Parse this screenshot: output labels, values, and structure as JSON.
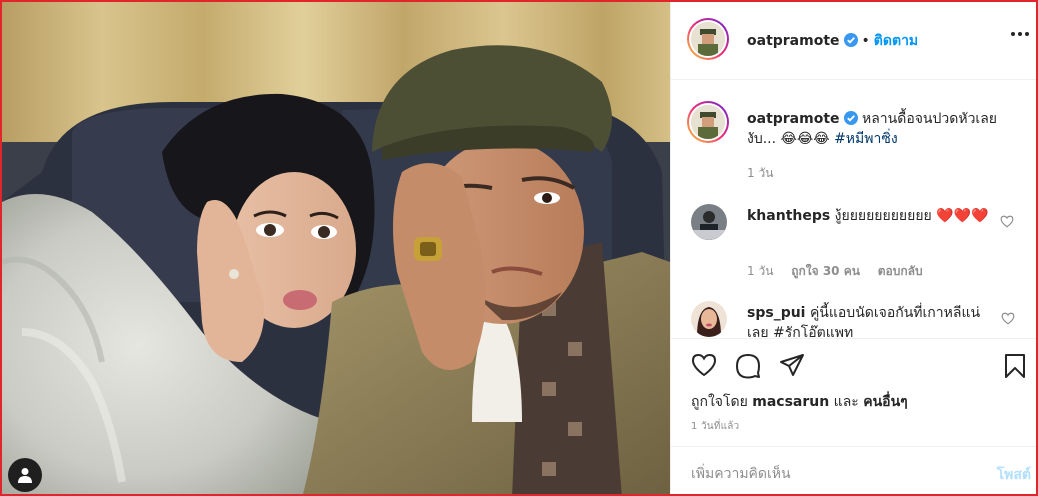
{
  "post": {
    "username": "oatpramote",
    "follow_label": "ติดตาม",
    "dot": "•",
    "verified": true
  },
  "caption": {
    "username": "oatpramote",
    "text": "หลานดื้อจนปวดหัวเลยงับ... 😂😂😂 ",
    "hashtag": "#หมีพาซิ่ง",
    "time": "1 วัน"
  },
  "comments": [
    {
      "username": "khantheps",
      "text": "งู้ยยยยยยยยยยย ❤️❤️❤️",
      "time": "1 วัน",
      "likes": "ถูกใจ 30 คน",
      "reply": "ตอบกลับ"
    },
    {
      "username": "sps_pui",
      "text": "คู่นี้แอบนัดเจอกันที่เกาหลีแน่เลย #รักโอ๊ตแพท"
    }
  ],
  "likes": {
    "prefix": "ถูกใจโดย",
    "user": "macsarun",
    "and": "และ",
    "others": "คนอื่นๆ"
  },
  "timeago": "1 วันที่แล้ว",
  "add_comment": {
    "placeholder": "เพิ่มความคิดเห็น",
    "post_label": "โพสต์"
  },
  "colors": {
    "accent": "#0095f6",
    "verified": "#3897f0",
    "border": "#e0262b"
  },
  "icons": {
    "like": "heart-icon",
    "comment": "comment-icon",
    "share": "paper-plane-icon",
    "save": "bookmark-icon",
    "more": "more-options-icon",
    "user_tag": "user-tag-icon"
  }
}
